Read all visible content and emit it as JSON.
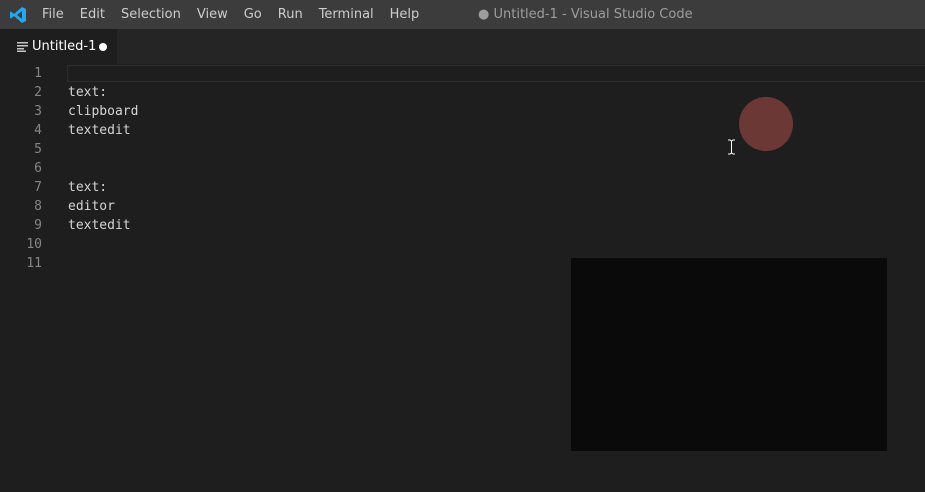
{
  "app": {
    "window_title": "● Untitled-1 - Visual Studio Code",
    "logo_icon": "vscode-logo-icon",
    "accent_color": "#23a9f2"
  },
  "menu": {
    "items": [
      {
        "label": "File"
      },
      {
        "label": "Edit"
      },
      {
        "label": "Selection"
      },
      {
        "label": "View"
      },
      {
        "label": "Go"
      },
      {
        "label": "Run"
      },
      {
        "label": "Terminal"
      },
      {
        "label": "Help"
      }
    ]
  },
  "tabs": [
    {
      "label": "Untitled-1",
      "icon": "lines-icon",
      "dirty": true
    }
  ],
  "editor": {
    "lines": [
      {
        "num": "1",
        "text": ""
      },
      {
        "num": "2",
        "text": "text:"
      },
      {
        "num": "3",
        "text": "clipboard"
      },
      {
        "num": "4",
        "text": "textedit"
      },
      {
        "num": "5",
        "text": ""
      },
      {
        "num": "6",
        "text": ""
      },
      {
        "num": "7",
        "text": "text:"
      },
      {
        "num": "8",
        "text": "editor"
      },
      {
        "num": "9",
        "text": "textedit"
      },
      {
        "num": "10",
        "text": ""
      },
      {
        "num": "11",
        "text": ""
      }
    ]
  },
  "colors": {
    "titlebar_bg": "#3c3c3c",
    "editor_bg": "#1e1e1e",
    "line_number": "#858585",
    "text": "#d4d4d4",
    "click_indicator": "#7a3d3b",
    "overlay_panel": "#0a0a0a"
  }
}
